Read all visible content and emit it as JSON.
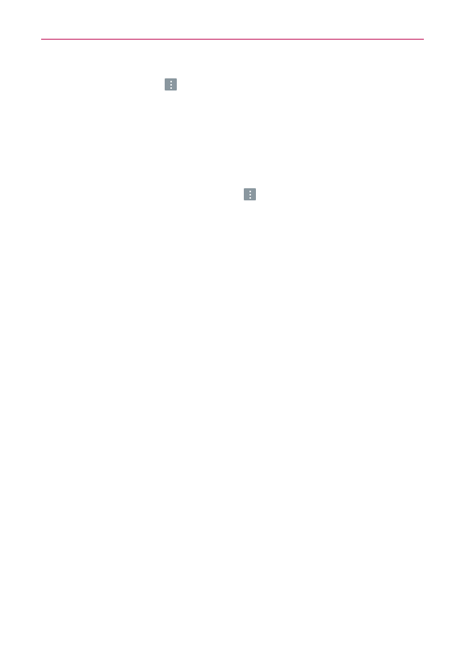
{
  "page": {
    "accent_color": "#c2185b",
    "background_color": "#ffffff"
  },
  "icons": [
    {
      "name": "overflow-menu-icon",
      "color": "#8a979f"
    },
    {
      "name": "overflow-menu-icon",
      "color": "#8a979f"
    }
  ]
}
